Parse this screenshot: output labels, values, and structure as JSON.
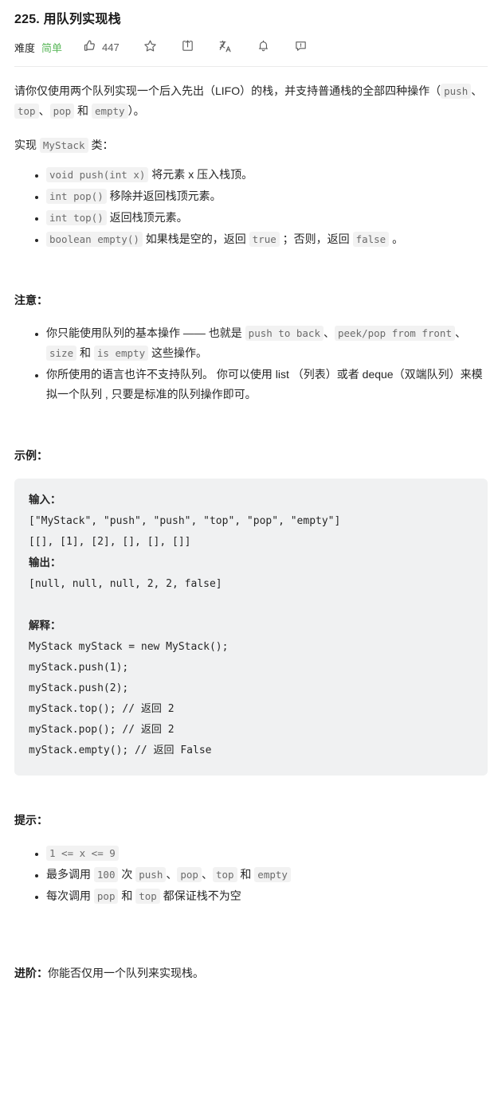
{
  "header": {
    "title": "225. 用队列实现栈",
    "difficulty_label": "难度",
    "difficulty_value": "简单",
    "difficulty_color": "#5cb85c",
    "like_count": "447",
    "icons": [
      "thumbs-up-icon",
      "star-icon",
      "share-icon",
      "translate-icon",
      "bell-icon",
      "feedback-icon"
    ]
  },
  "description": {
    "intro_1": "请你仅使用两个队列实现一个后入先出（LIFO）的栈，并支持普通栈的全部四种操作（",
    "intro_code_1": "push",
    "intro_sep_1": "、",
    "intro_code_2": "top",
    "intro_sep_2": "、",
    "intro_code_3": "pop",
    "intro_sep_3": " 和 ",
    "intro_code_4": "empty",
    "intro_end": "）。",
    "implement_prefix": "实现 ",
    "implement_class": "MyStack",
    "implement_suffix": " 类：",
    "methods": [
      {
        "code": "void push(int x)",
        "text": " 将元素 x 压入栈顶。"
      },
      {
        "code": "int pop()",
        "text": " 移除并返回栈顶元素。"
      },
      {
        "code": "int top()",
        "text": " 返回栈顶元素。"
      }
    ],
    "method_empty_code": "boolean empty()",
    "method_empty_text_1": " 如果栈是空的，返回 ",
    "method_empty_true": "true",
    "method_empty_text_2": " ；否则，返回 ",
    "method_empty_false": "false",
    "method_empty_text_3": " 。"
  },
  "notes": {
    "heading": "注意：",
    "bullet1_t1": "你只能使用队列的基本操作 —— 也就是 ",
    "bullet1_c1": "push to back",
    "bullet1_t2": "、",
    "bullet1_c2": "peek/pop from front",
    "bullet1_t3": "、",
    "bullet1_c3": "size",
    "bullet1_t4": " 和 ",
    "bullet1_c4": "is empty",
    "bullet1_t5": " 这些操作。",
    "bullet2": "你所使用的语言也许不支持队列。 你可以使用 list （列表）或者 deque（双端队列）来模拟一个队列 , 只要是标准的队列操作即可。"
  },
  "example": {
    "heading": "示例：",
    "input_label": "输入：",
    "input_line_1": "[\"MyStack\", \"push\", \"push\", \"top\", \"pop\", \"empty\"]",
    "input_line_2": "[[], [1], [2], [], [], []]",
    "output_label": "输出：",
    "output_line": "[null, null, null, 2, 2, false]",
    "explain_label": "解释：",
    "explain_lines": [
      "MyStack myStack = new MyStack();",
      "myStack.push(1);",
      "myStack.push(2);",
      "myStack.top(); // 返回 2",
      "myStack.pop(); // 返回 2",
      "myStack.empty(); // 返回 False"
    ]
  },
  "hints": {
    "heading": "提示：",
    "bullet1_code": "1 <= x <= 9",
    "bullet2_t1": "最多调用 ",
    "bullet2_c1": "100",
    "bullet2_t2": " 次 ",
    "bullet2_c2": "push",
    "bullet2_t3": "、",
    "bullet2_c3": "pop",
    "bullet2_t4": "、",
    "bullet2_c4": "top",
    "bullet2_t5": " 和 ",
    "bullet2_c5": "empty",
    "bullet3_t1": "每次调用 ",
    "bullet3_c1": "pop",
    "bullet3_t2": " 和 ",
    "bullet3_c2": "top",
    "bullet3_t3": " 都保证栈不为空"
  },
  "advanced": {
    "label": "进阶：",
    "text": "你能否仅用一个队列来实现栈。"
  }
}
